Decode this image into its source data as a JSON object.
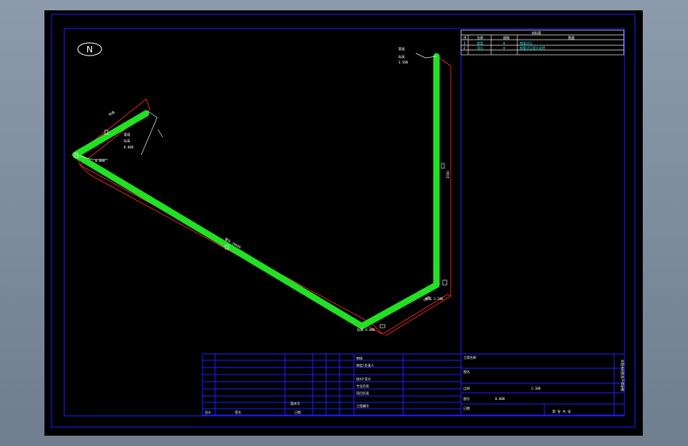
{
  "north_symbol": {
    "letter": "N",
    "icon": "north-arrow-icon"
  },
  "material_table": {
    "title": "材料表",
    "headers": [
      "序",
      "名称",
      "规格",
      "数量"
    ],
    "rows": [
      [
        "1",
        "钢管",
        "Φ",
        "钢管详见"
      ],
      [
        "2",
        "弯头",
        "Φ",
        "钢管详见弯头说明"
      ]
    ]
  },
  "dimensions": {
    "left_leg": "标高",
    "left_node": "0.000",
    "long_run": "管长 10000",
    "corner_bottom": "标高 0.000",
    "short_run": "1000",
    "riser_note": "标高 3.500",
    "riser_dim": "3500",
    "top_note_1": "管道",
    "top_note_2": "标高",
    "top_note_3": "3.500",
    "left_note_1": "管道",
    "left_note_2": "标高",
    "left_note_3": "0.000"
  },
  "title_block": {
    "labels": [
      "审核",
      "审定/负责人",
      "校对/设计",
      "专业负责",
      "项目负责",
      "工程编号",
      "设计",
      "签名",
      "日期"
    ],
    "project_name": "工程名称",
    "drawing_name": "图名",
    "scale_label": "比例",
    "scale_value": "1:100",
    "drawing_no_label": "图号",
    "drawing_no_value": "0.000",
    "date_label": "日期",
    "sheet_label": "第 张 共 张",
    "version": "版本号",
    "side_note": "本图未经批准不得复制"
  }
}
